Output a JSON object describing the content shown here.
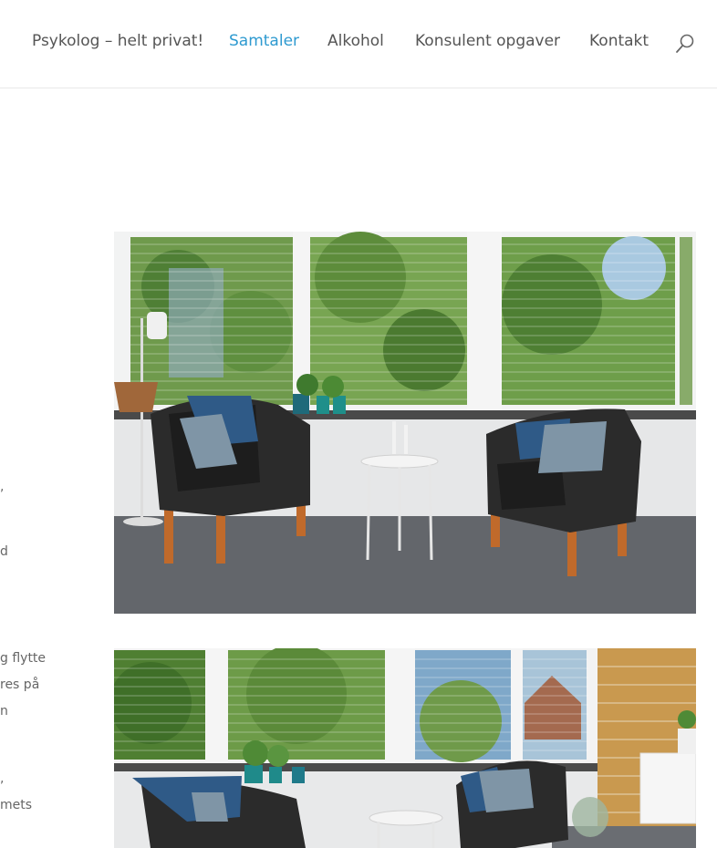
{
  "nav": {
    "items": [
      {
        "label": "Psykolog – helt privat!",
        "active": false
      },
      {
        "label": "Samtaler",
        "active": true
      },
      {
        "label": "Alkohol",
        "active": false
      },
      {
        "label": "Konsulent opgaver",
        "active": false
      },
      {
        "label": "Kontakt",
        "active": false
      }
    ],
    "search_icon": "search-icon",
    "active_color": "#2e9ad0",
    "text_color": "#555555"
  },
  "left_column_fragments": [
    ",",
    "d",
    "g flytte",
    "res på",
    "n",
    ",",
    "mets"
  ],
  "images": [
    {
      "name": "therapy-room-photo-1"
    },
    {
      "name": "therapy-room-photo-2"
    }
  ]
}
